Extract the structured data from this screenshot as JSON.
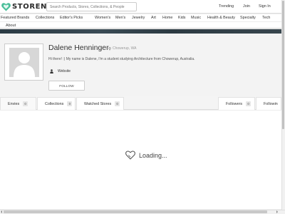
{
  "brand": {
    "name": "STORENVY",
    "accent": "#4bbf9a"
  },
  "search": {
    "placeholder": "Search Products, Stores, Collections, & People"
  },
  "topnav": {
    "trending": "Trending",
    "join": "Join",
    "signin": "Sign In"
  },
  "nav": [
    {
      "label": "Featured Brands"
    },
    {
      "label": "Collections"
    },
    {
      "label": "Editor's Picks"
    },
    {
      "label": "Women's"
    },
    {
      "label": "Men's"
    },
    {
      "label": "Jewelry"
    },
    {
      "label": "Art"
    },
    {
      "label": "Home"
    },
    {
      "label": "Kids"
    },
    {
      "label": "Music"
    },
    {
      "label": "Health & Beauty"
    },
    {
      "label": "Specialty"
    },
    {
      "label": "Tech"
    }
  ],
  "nav_about": "About",
  "profile": {
    "name": "Dalene Henninger",
    "location": "Chowerup, WA",
    "bio": "Hi there! :) My name is Dalene, I'm a student studying Architecture from Chowerup, Australia.",
    "website_label": "Website",
    "follow_label": "FOLLOW"
  },
  "tabs": [
    {
      "label": "Envies",
      "count": "0"
    },
    {
      "label": "Collections",
      "count": "0"
    },
    {
      "label": "Watched Stores",
      "count": "0"
    },
    {
      "label": "Followers",
      "count": "0"
    },
    {
      "label": "Followin",
      "count": ""
    }
  ],
  "loading_text": "Loading..."
}
